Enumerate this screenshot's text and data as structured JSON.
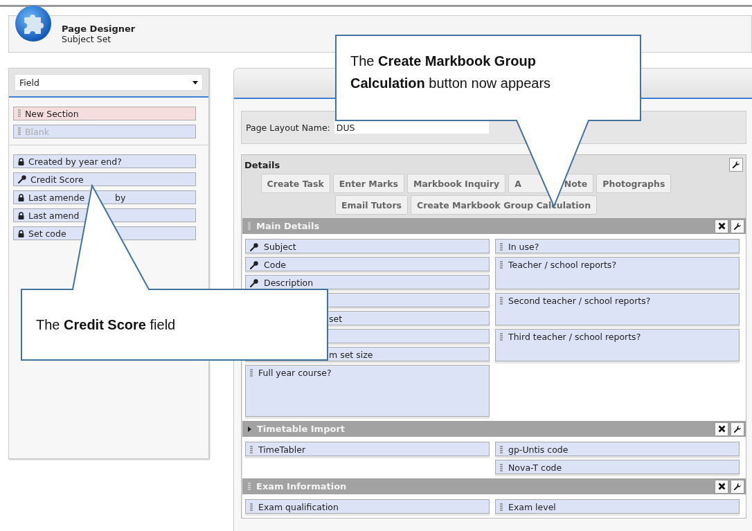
{
  "header": {
    "title": "Page Designer",
    "subtitle": "Subject Set"
  },
  "palette": {
    "selector": "Field",
    "items": [
      {
        "label": "New Section",
        "kind": "section",
        "disabled": false
      },
      {
        "label": "Blank",
        "kind": "field",
        "disabled": true
      }
    ],
    "fields": [
      {
        "label": "Created by year end?",
        "kind": "locked"
      },
      {
        "label": "Credit Score",
        "kind": "key"
      },
      {
        "label": "Last amende",
        "tail": "by",
        "kind": "locked"
      },
      {
        "label": "Last amend",
        "kind": "locked"
      },
      {
        "label": "Set code",
        "kind": "locked"
      }
    ]
  },
  "layout": {
    "name_label": "Page Layout Name:",
    "name_value": "DUS",
    "details": {
      "title": "Details",
      "button_rows": [
        [
          {
            "label": "Create Task"
          },
          {
            "label": "Enter Marks"
          },
          {
            "label": "Markbook Inquiry"
          },
          {
            "label": "A",
            "tail": "Note"
          },
          {
            "label": "Photographs"
          }
        ],
        [
          {
            "label": "Email Tutors"
          },
          {
            "label": "Create Markbook Group Calculation"
          }
        ]
      ]
    },
    "sections": [
      {
        "title": "Main Details",
        "kind": "fixed",
        "left": [
          {
            "label": "Subject",
            "kind": "key"
          },
          {
            "label": "Code",
            "kind": "key"
          },
          {
            "label": "Description",
            "kind": "key"
          },
          {
            "kind": "covered"
          },
          {
            "label": "set",
            "kind": "covered"
          },
          {
            "kind": "covered"
          },
          {
            "label": "m set size",
            "kind": "covered"
          },
          {
            "label": "Full year course?",
            "kind": "large"
          }
        ],
        "right": [
          {
            "label": "In use?",
            "kind": "plain"
          },
          {
            "label": "Teacher / school reports?",
            "kind": "tall"
          },
          {
            "label": "Second teacher / school reports?",
            "kind": "tall"
          },
          {
            "label": "Third teacher / school reports?",
            "kind": "tall"
          }
        ]
      },
      {
        "title": "Timetable Import",
        "kind": "collapsible",
        "left": [
          {
            "label": "TimeTabler",
            "kind": "plain"
          }
        ],
        "right": [
          {
            "label": "gp-Untis code",
            "kind": "plain"
          },
          {
            "label": "Nova-T code",
            "kind": "plain"
          }
        ]
      },
      {
        "title": "Exam Information",
        "kind": "fixed",
        "left": [
          {
            "label": "Exam qualification",
            "kind": "plain"
          }
        ],
        "right": [
          {
            "label": "Exam level",
            "kind": "plain"
          }
        ]
      }
    ]
  },
  "callouts": [
    {
      "text": "The **Create Markbook Group Calculation** button now appears"
    },
    {
      "text": "The **Credit Score** field"
    }
  ]
}
